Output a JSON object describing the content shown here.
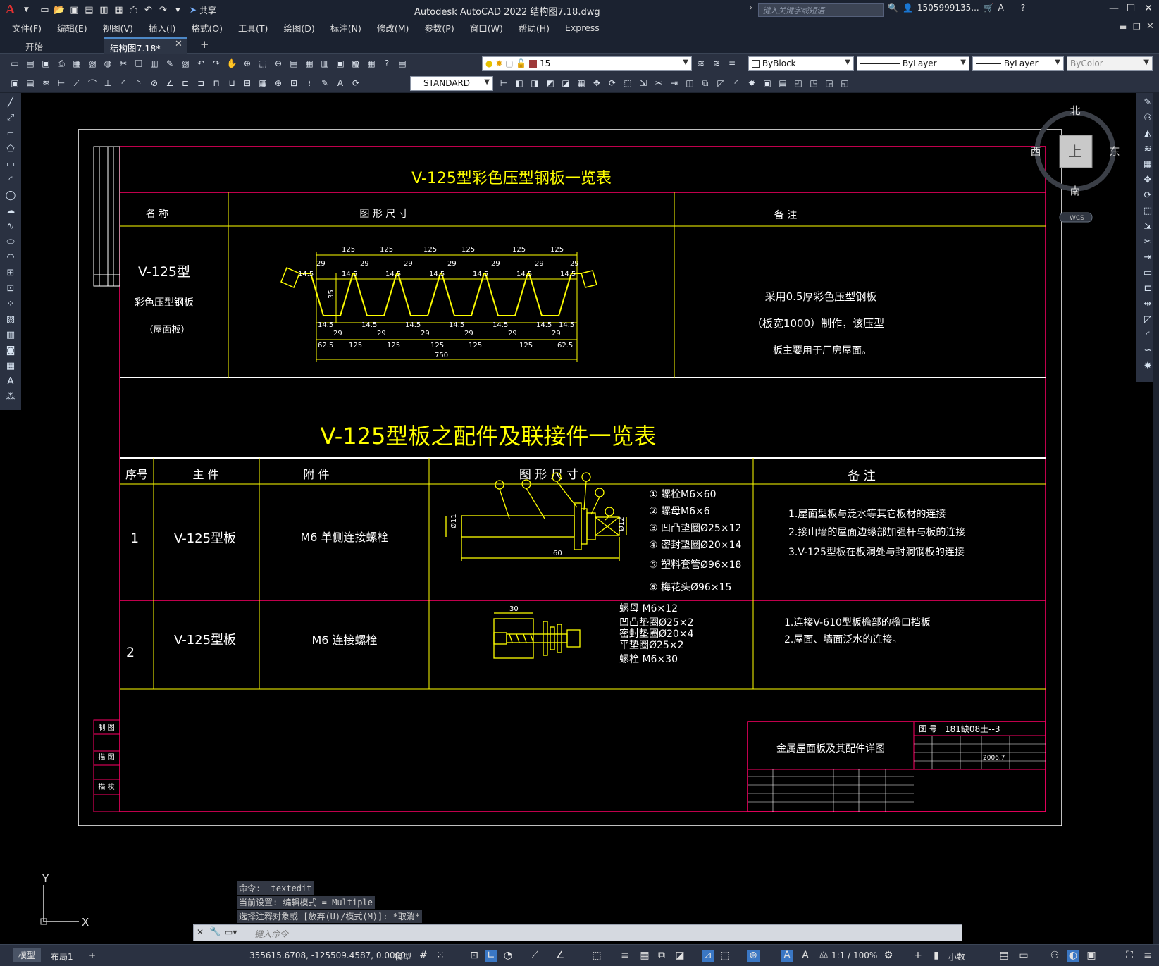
{
  "titlebar": {
    "logo": "A",
    "share_label": "共享",
    "title": "Autodesk AutoCAD 2022    结构图7.18.dwg",
    "search_placeholder": "键入关键字或短语",
    "user": "1505999135...",
    "help": "?"
  },
  "menu": [
    "文件(F)",
    "编辑(E)",
    "视图(V)",
    "插入(I)",
    "格式(O)",
    "工具(T)",
    "绘图(D)",
    "标注(N)",
    "修改(M)",
    "参数(P)",
    "窗口(W)",
    "帮助(H)",
    "Express"
  ],
  "tabs": {
    "start": "开始",
    "active": "结构图7.18*",
    "close": "✕",
    "add": "+"
  },
  "toolbar": {
    "layer_value": "15",
    "color_value": "ByBlock",
    "linetype_value": "ByLayer",
    "lineweight_value": "ByLayer",
    "plotstyle_value": "ByColor",
    "textstyle_value": "STANDARD"
  },
  "viewcube": {
    "north": "北",
    "south": "南",
    "east": "东",
    "west": "西",
    "top": "上",
    "wcs": "WCS"
  },
  "ucs": {
    "x": "X",
    "y": "Y"
  },
  "drawing": {
    "table1": {
      "title": "V-125型彩色压型钢板一览表",
      "h_name": "名  称",
      "h_dim": "图 形 尺 寸",
      "h_note": "备  注",
      "name_l1": "V-125型",
      "name_l2": "彩色压型钢板",
      "name_l3": "（屋面板）",
      "note_l1": "采用0.5厚彩色压型钢板",
      "note_l2": "（板宽1000）制作，该压型",
      "note_l3": "板主要用于厂房屋面。",
      "dim_top": "125",
      "dim_29": "29",
      "dim_145": "14.5",
      "dim_35": "35",
      "dim_625": "62.5",
      "dim_750": "750"
    },
    "table2": {
      "title": "V-125型板之配件及联接件一览表",
      "h_no": "序号",
      "h_main": "主 件",
      "h_att": "附 件",
      "h_dim": "图 形 尺 寸",
      "h_note": "备  注",
      "r1_no": "1",
      "r1_main": "V-125型板",
      "r1_att": "M6 单侧连接螺栓",
      "r1_parts": [
        "① 螺栓M6×60",
        "② 螺母M6×6",
        "③ 凹凸垫圈Ø25×12",
        "④ 密封垫圈Ø20×14",
        "⑤ 塑料套管Ø96×18",
        "⑥ 梅花头Ø96×15"
      ],
      "r1_dim60": "60",
      "r1_dim11": "Ø11",
      "r1_dim12": "Ø12",
      "r1_notes": [
        "1.屋面型板与泛水等其它板材的连接",
        "2.接山墙的屋面边缘部加强杆与板的连接",
        "3.V-125型板在板洞处与封洞钢板的连接"
      ],
      "r2_no": "2",
      "r2_main": "V-125型板",
      "r2_att": "M6 连接螺栓",
      "r2_dim30": "30",
      "r2_parts": [
        "螺母   M6×12",
        "凹凸垫圈Ø25×2",
        "密封垫圈Ø20×4",
        "平垫圈Ø25×2",
        "螺栓  M6×30"
      ],
      "r2_notes": [
        "1.连接V-610型板檐部的檐口挡板",
        "2.屋面、墙面泛水的连接。"
      ]
    },
    "titleblock": {
      "drawing_name": "金属屋面板及其配件详图",
      "fig_no_label": "图  号",
      "fig_no": "181缺08土--3",
      "date": "2006.7",
      "side_labels": [
        "制 图",
        "描 图",
        "描 校"
      ]
    }
  },
  "command": {
    "line1": "命令: _textedit",
    "line2": "当前设置: 编辑模式 = Multiple",
    "line3": "选择注释对象或 [放弃(U)/模式(M)]: *取消*",
    "placeholder": "键入命令"
  },
  "status": {
    "tab_model": "模型",
    "tab_layout": "布局1",
    "coords": "355615.6708, -125509.4587, 0.0000",
    "mode": "模型",
    "scale": "1:1 / 100%",
    "units": "小数"
  },
  "colors": {
    "frame": "#ffffff",
    "yellow": "#ffff00",
    "magenta": "#ff0066",
    "bg": "#000000",
    "ui": "#2a3141"
  }
}
